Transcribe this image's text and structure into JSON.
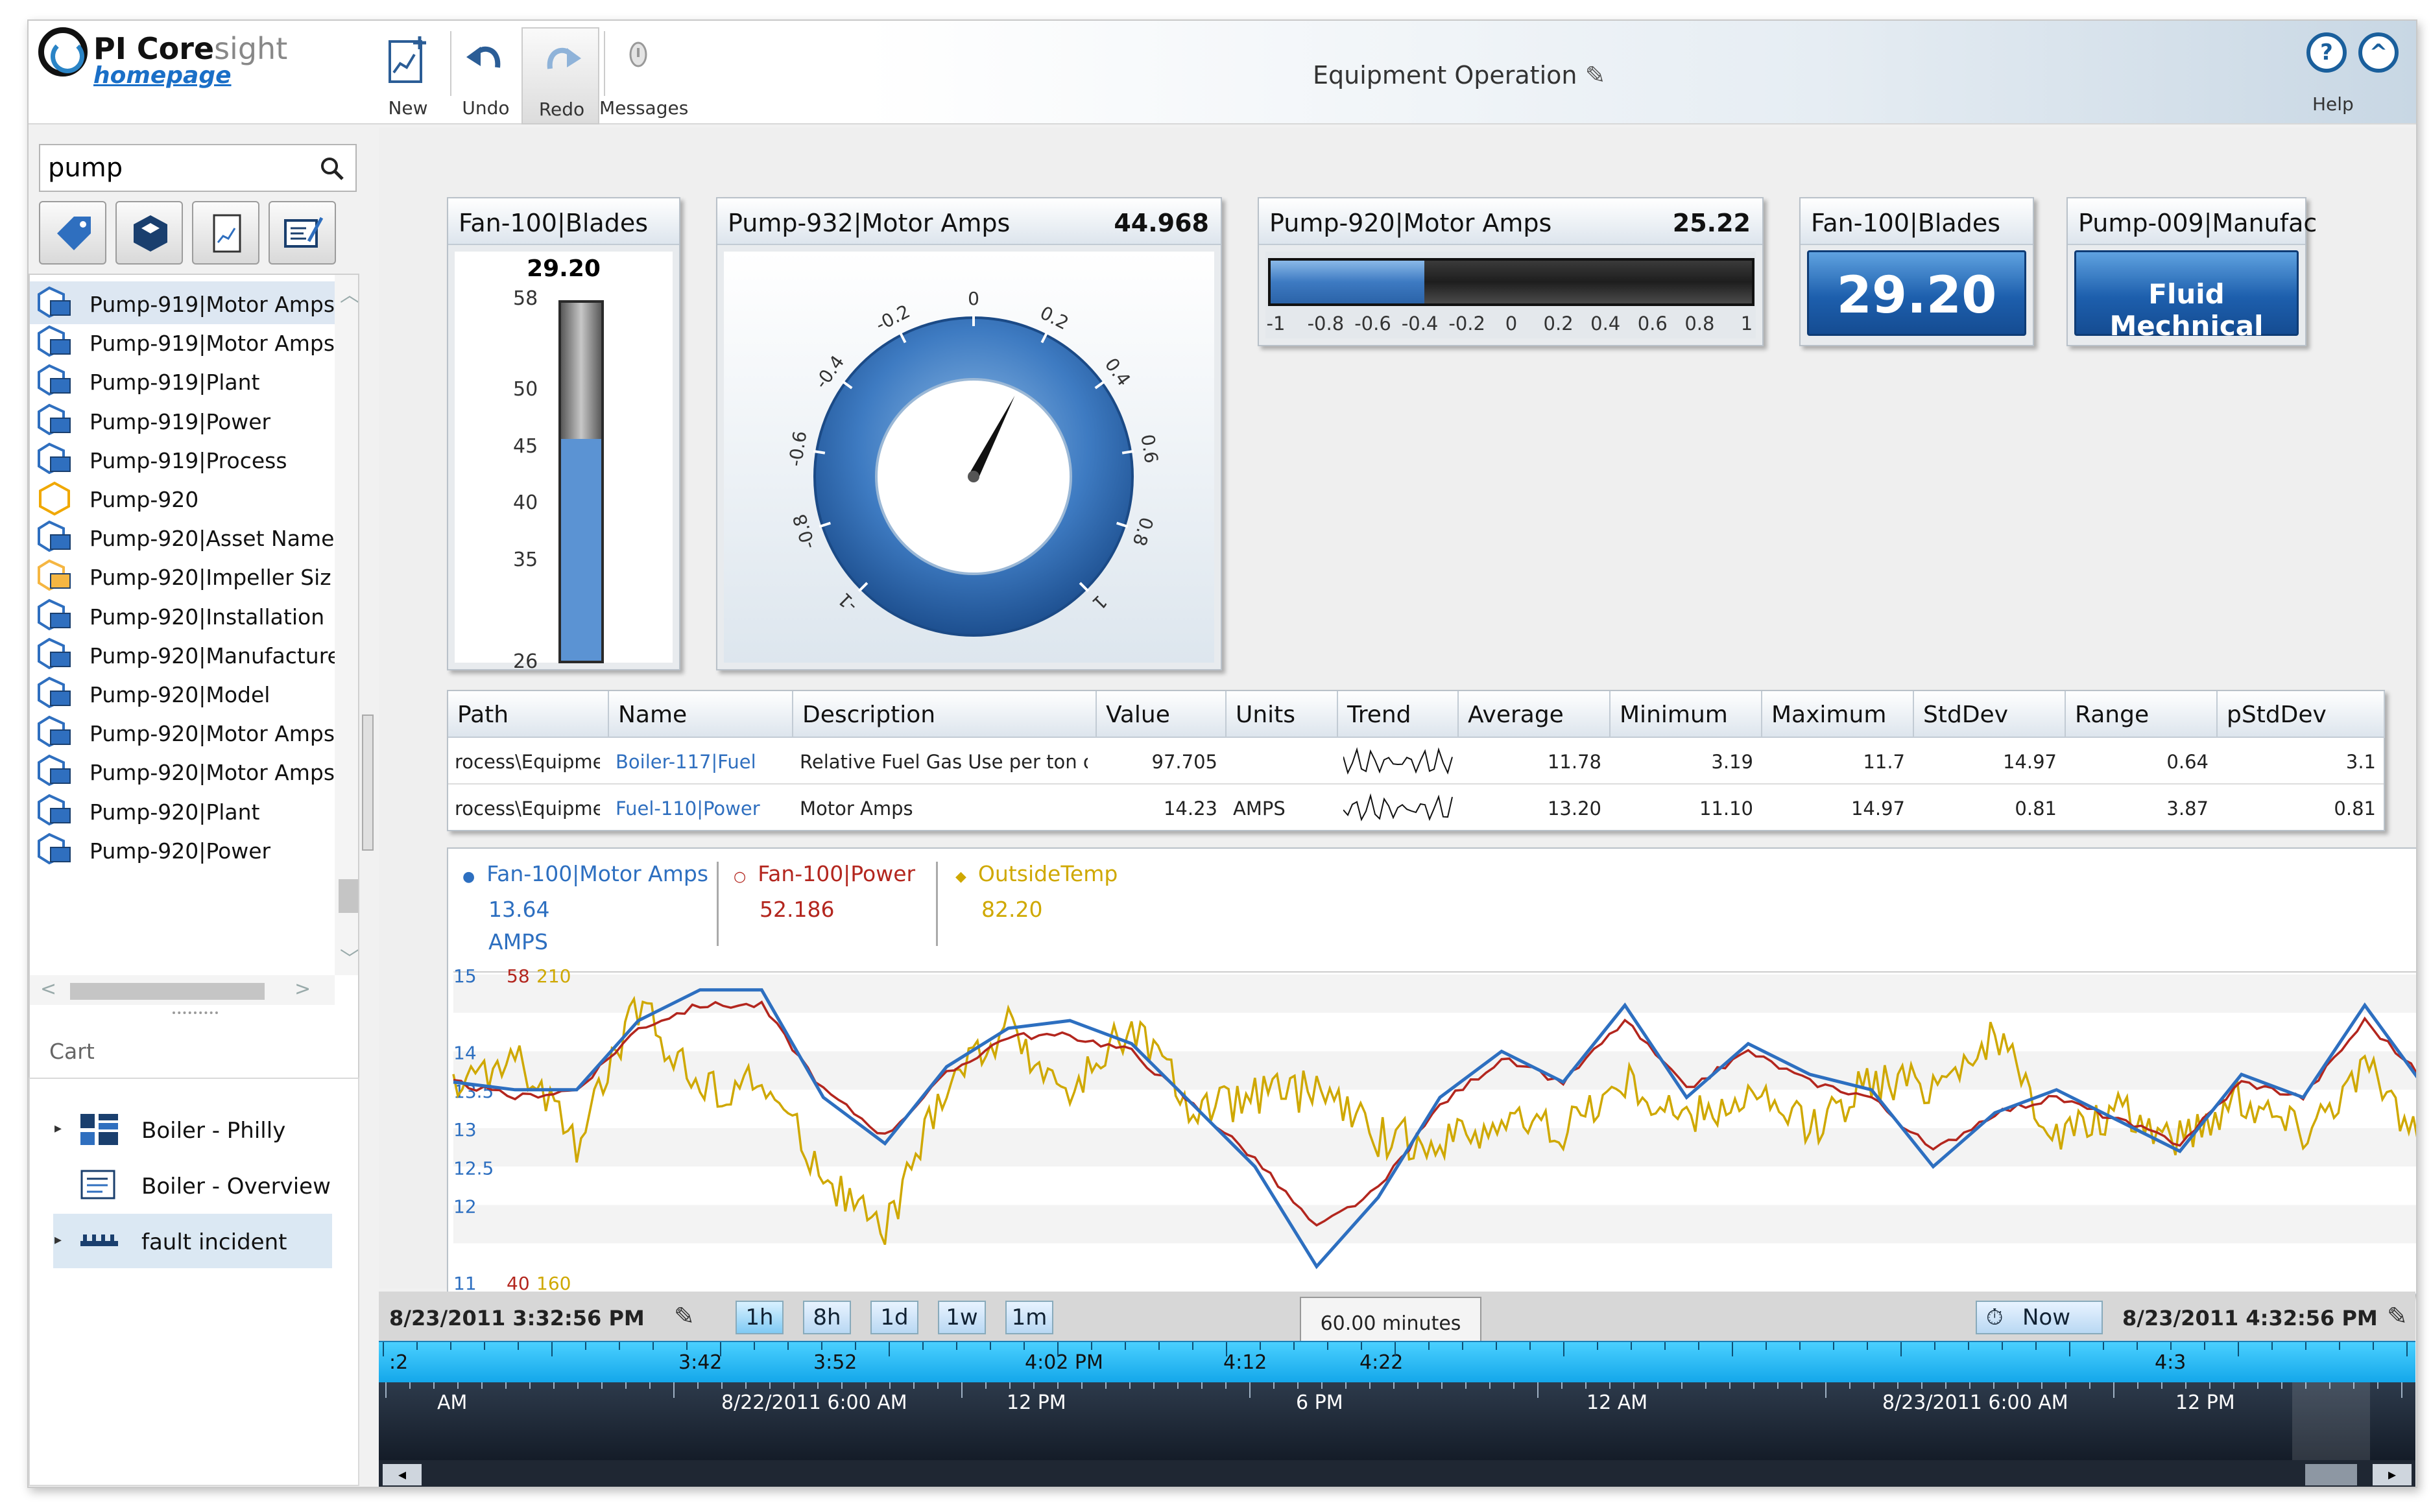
{
  "header": {
    "logo_title": "PI Core",
    "logo_title_light": "sight",
    "logo_sub": "homepage",
    "toolbar": [
      {
        "label": "New",
        "icon": "new-display-icon"
      },
      {
        "label": "Undo",
        "icon": "undo-icon"
      },
      {
        "label": "Redo",
        "icon": "redo-icon"
      },
      {
        "label": "Messages",
        "icon": "messages-icon"
      }
    ],
    "page_title": "Equipment Operation",
    "help_label": "Help",
    "help_symbol": "?",
    "collapse_symbol": "^"
  },
  "sidebar": {
    "search_value": "pump",
    "filter_buttons": [
      "tag-filter-icon",
      "asset-filter-icon",
      "display-filter-icon",
      "attribute-filter-icon"
    ],
    "results": [
      {
        "label": "Pump-919|Motor Amps",
        "type": "attribute"
      },
      {
        "label": "Pump-919|Motor Amps",
        "type": "attribute"
      },
      {
        "label": "Pump-919|Plant",
        "type": "attribute"
      },
      {
        "label": "Pump-919|Power",
        "type": "attribute"
      },
      {
        "label": "Pump-919|Process",
        "type": "attribute"
      },
      {
        "label": "Pump-920",
        "type": "element"
      },
      {
        "label": "Pump-920|Asset Name",
        "type": "attribute"
      },
      {
        "label": "Pump-920|Impeller Siz",
        "type": "static"
      },
      {
        "label": "Pump-920|Installation",
        "type": "attribute"
      },
      {
        "label": "Pump-920|Manufacture",
        "type": "attribute"
      },
      {
        "label": "Pump-920|Model",
        "type": "attribute"
      },
      {
        "label": "Pump-920|Motor Amps",
        "type": "attribute"
      },
      {
        "label": "Pump-920|Motor Amps",
        "type": "attribute"
      },
      {
        "label": "Pump-920|Plant",
        "type": "attribute"
      },
      {
        "label": "Pump-920|Power",
        "type": "attribute"
      }
    ],
    "cart_label": "Cart",
    "cart": [
      {
        "label": "Boiler - Philly",
        "icon": "dashboard-icon",
        "expandable": true
      },
      {
        "label": "Boiler - Overview",
        "icon": "display-icon",
        "expandable": false
      },
      {
        "label": "fault incident",
        "icon": "timeline-icon",
        "expandable": true
      }
    ]
  },
  "symbols": {
    "vbar": {
      "title": "Fan-100|Blades",
      "value": "29.20",
      "ticks": [
        "58",
        "50",
        "45",
        "40",
        "35",
        "26"
      ],
      "min": 26,
      "max": 58,
      "reading": 29.2,
      "bar_color": "#5b93d3"
    },
    "gauge": {
      "title": "Pump-932|Motor Amps",
      "value": "44.968",
      "ticks": [
        "-1",
        "-0.8",
        "-0.6",
        "-0.4",
        "-0.2",
        "0",
        "0.2",
        "0.4",
        "0.6",
        "0.8",
        "1"
      ],
      "pointer_fraction": 0.6
    },
    "hbar": {
      "title": "Pump-920|Motor Amps",
      "value": "25.22",
      "ticks": [
        "-1",
        "-0.8",
        "-0.6",
        "-0.4",
        "-0.2",
        "0",
        "0.2",
        "0.4",
        "0.6",
        "0.8",
        "1"
      ],
      "fill_fraction": 0.32
    },
    "value1": {
      "title": "Fan-100|Blades",
      "value": "29.20"
    },
    "value2": {
      "title": "Pump-009|Manufac",
      "value": "Fluid Mechnical"
    }
  },
  "table": {
    "columns": [
      "Path",
      "Name",
      "Description",
      "Value",
      "Units",
      "Trend",
      "Average",
      "Minimum",
      "Maximum",
      "StdDev",
      "Range",
      "pStdDev"
    ],
    "rows": [
      {
        "path": "rocess\\Equipment",
        "name": "Boiler-117|Fuel",
        "description": "Relative Fuel Gas Use per ton of Fee",
        "value": "97.705",
        "units": "",
        "average": "11.78",
        "minimum": "3.19",
        "maximum": "11.7",
        "stddev": "14.97",
        "range": "0.64",
        "pstddev": "3.1"
      },
      {
        "path": "rocess\\Equipment",
        "name": "Fuel-110|Power",
        "description": "Motor Amps",
        "value": "14.23",
        "units": "AMPS",
        "average": "13.20",
        "minimum": "11.10",
        "maximum": "14.97",
        "stddev": "0.81",
        "range": "3.87",
        "pstddev": "0.81"
      }
    ]
  },
  "trend": {
    "legend": [
      {
        "name": "Fan-100|Motor Amps",
        "value": "13.64",
        "units": "AMPS",
        "color": "#2d6fc0",
        "marker": "●"
      },
      {
        "name": "Fan-100|Power",
        "value": "52.186",
        "units": "",
        "color": "#b3261e",
        "marker": "○"
      },
      {
        "name": "OutsideTemp",
        "value": "82.20",
        "units": "",
        "color": "#cfa800",
        "marker": "◆"
      }
    ],
    "y_axis_blue": [
      "15",
      "14",
      "13.5",
      "13",
      "12.5",
      "12",
      "11"
    ],
    "y_axis_red": [
      "58",
      "40"
    ],
    "y_axis_yellow": [
      "210",
      "160"
    ]
  },
  "chart_data": {
    "type": "line",
    "title": "",
    "xlabel": "",
    "ylabel": "",
    "x_range": [
      "8/23/2011 3:32:56 PM",
      "8/23/2011 4:32:56 PM"
    ],
    "ylim": [
      11,
      15
    ],
    "series": [
      {
        "name": "Fan-100|Motor Amps",
        "color": "#2d6fc0",
        "values": [
          13.6,
          13.5,
          13.5,
          14.4,
          14.8,
          14.8,
          13.4,
          12.8,
          13.8,
          14.3,
          14.4,
          14.1,
          13.3,
          12.5,
          11.2,
          12.1,
          13.4,
          14.0,
          13.6,
          14.6,
          13.4,
          14.1,
          13.7,
          13.5,
          12.5,
          13.2,
          13.5,
          13.1,
          12.7,
          13.7,
          13.4,
          14.6,
          13.5
        ]
      },
      {
        "name": "Fan-100|Power",
        "color": "#b3261e",
        "values": [
          13.6,
          13.4,
          13.5,
          14.3,
          14.6,
          14.6,
          13.5,
          12.9,
          13.7,
          14.2,
          14.2,
          14.0,
          13.3,
          12.6,
          11.7,
          12.2,
          13.3,
          13.9,
          13.6,
          14.4,
          13.5,
          14.0,
          13.6,
          13.4,
          12.7,
          13.2,
          13.4,
          13.1,
          12.8,
          13.6,
          13.4,
          14.4,
          13.6
        ]
      },
      {
        "name": "OutsideTemp",
        "color": "#cfa800",
        "values": [
          13.5,
          13.9,
          12.8,
          14.6,
          13.5,
          13.6,
          12.4,
          11.6,
          13.6,
          14.3,
          13.4,
          14.4,
          13.2,
          13.4,
          13.5,
          12.9,
          12.8,
          13.1,
          13.0,
          13.6,
          13.1,
          13.4,
          13.0,
          13.6,
          13.6,
          14.2,
          12.9,
          13.2,
          12.9,
          13.4,
          13.0,
          13.8,
          12.7
        ]
      }
    ]
  },
  "timebar": {
    "start": "8/23/2011 3:32:56 PM",
    "end": "8/23/2011 4:32:56 PM",
    "ranges": [
      "1h",
      "8h",
      "1d",
      "1w",
      "1m"
    ],
    "duration": "60.00 minutes",
    "now_label": "Now",
    "fine_ticks": [
      ":2",
      "3:42",
      "3:52",
      "4:02 PM",
      "4:12",
      "4:22",
      "4:3"
    ],
    "coarse_ticks": [
      "AM",
      "8/22/2011 6:00 AM",
      "12 PM",
      "6 PM",
      "12 AM",
      "8/23/2011 6:00 AM",
      "12 PM"
    ]
  }
}
